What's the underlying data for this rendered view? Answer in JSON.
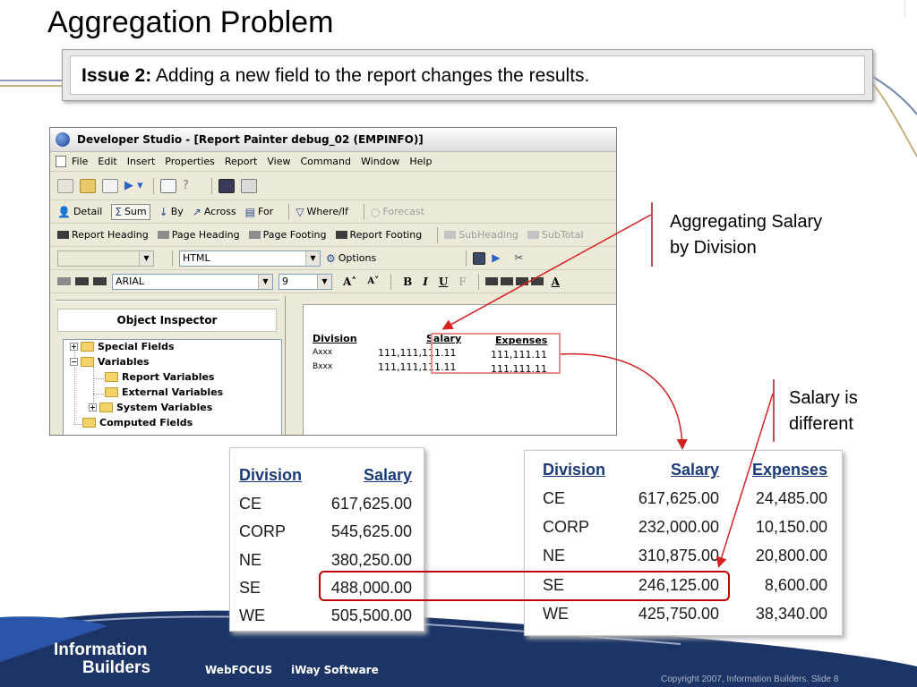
{
  "slide": {
    "title": "Aggregation Problem",
    "issue": {
      "label": "Issue 2:",
      "text": " Adding a new field to the report changes the results."
    },
    "annotations": {
      "aggregating": [
        "Aggregating Salary",
        "by Division"
      ],
      "different": [
        "Salary is",
        "different"
      ]
    },
    "footer": {
      "logo_line1": "Information",
      "logo_line2": "Builders",
      "links": [
        "WebFOCUS",
        "iWay Software"
      ],
      "copyright": "Copyright 2007, Information Builders. Slide 8"
    },
    "colors": {
      "highlight_red": "#c00000",
      "arrow_red": "#d42020",
      "header_blue": "#1a3a78"
    }
  },
  "window": {
    "title": "Developer Studio - [Report Painter debug_02 (EMPINFO)]",
    "menu": [
      "File",
      "Edit",
      "Insert",
      "Properties",
      "Report",
      "View",
      "Command",
      "Window",
      "Help"
    ],
    "toolbar_report": [
      {
        "label": "Detail",
        "icon": "detail-icon"
      },
      {
        "label": "Sum",
        "icon": "sigma-icon"
      },
      {
        "label": "By",
        "icon": "by-icon"
      },
      {
        "label": "Across",
        "icon": "across-icon"
      },
      {
        "label": "For",
        "icon": "for-icon"
      },
      {
        "label": "Where/If",
        "icon": "filter-icon"
      },
      {
        "label": "Forecast",
        "icon": "forecast-icon"
      }
    ],
    "toolbar_headings": [
      "Report Heading",
      "Page Heading",
      "Page Footing",
      "Report Footing",
      "SubHeading",
      "SubTotal"
    ],
    "format_combo": "HTML",
    "options_label": "Options",
    "font_name": "ARIAL",
    "font_size": "9",
    "format_buttons": [
      "B",
      "I",
      "U",
      "F"
    ],
    "object_inspector": {
      "title": "Object Inspector",
      "tree": [
        "Special Fields",
        "Variables",
        "Report Variables",
        "External Variables",
        "System Variables",
        "Computed Fields"
      ]
    },
    "report_canvas": {
      "headers": {
        "division": "Division",
        "salary": "Salary",
        "expenses": "Expenses"
      },
      "rows": [
        {
          "division": "Axxx",
          "salary": "111,111,111.11",
          "expenses": "111,111.11"
        },
        {
          "division": "Bxxx",
          "salary": "111,111,111.11",
          "expenses": "111,111.11"
        }
      ]
    }
  },
  "table_left": {
    "headers": [
      "Division",
      "Salary"
    ],
    "rows": [
      [
        "CE",
        "617,625.00"
      ],
      [
        "CORP",
        "545,625.00"
      ],
      [
        "NE",
        "380,250.00"
      ],
      [
        "SE",
        "488,000.00"
      ],
      [
        "WE",
        "505,500.00"
      ]
    ]
  },
  "table_right": {
    "headers": [
      "Division",
      "Salary",
      "Expenses"
    ],
    "rows": [
      [
        "CE",
        "617,625.00",
        "24,485.00"
      ],
      [
        "CORP",
        "232,000.00",
        "10,150.00"
      ],
      [
        "NE",
        "310,875.00",
        "20,800.00"
      ],
      [
        "SE",
        "246,125.00",
        "8,600.00"
      ],
      [
        "WE",
        "425,750.00",
        "38,340.00"
      ]
    ]
  }
}
